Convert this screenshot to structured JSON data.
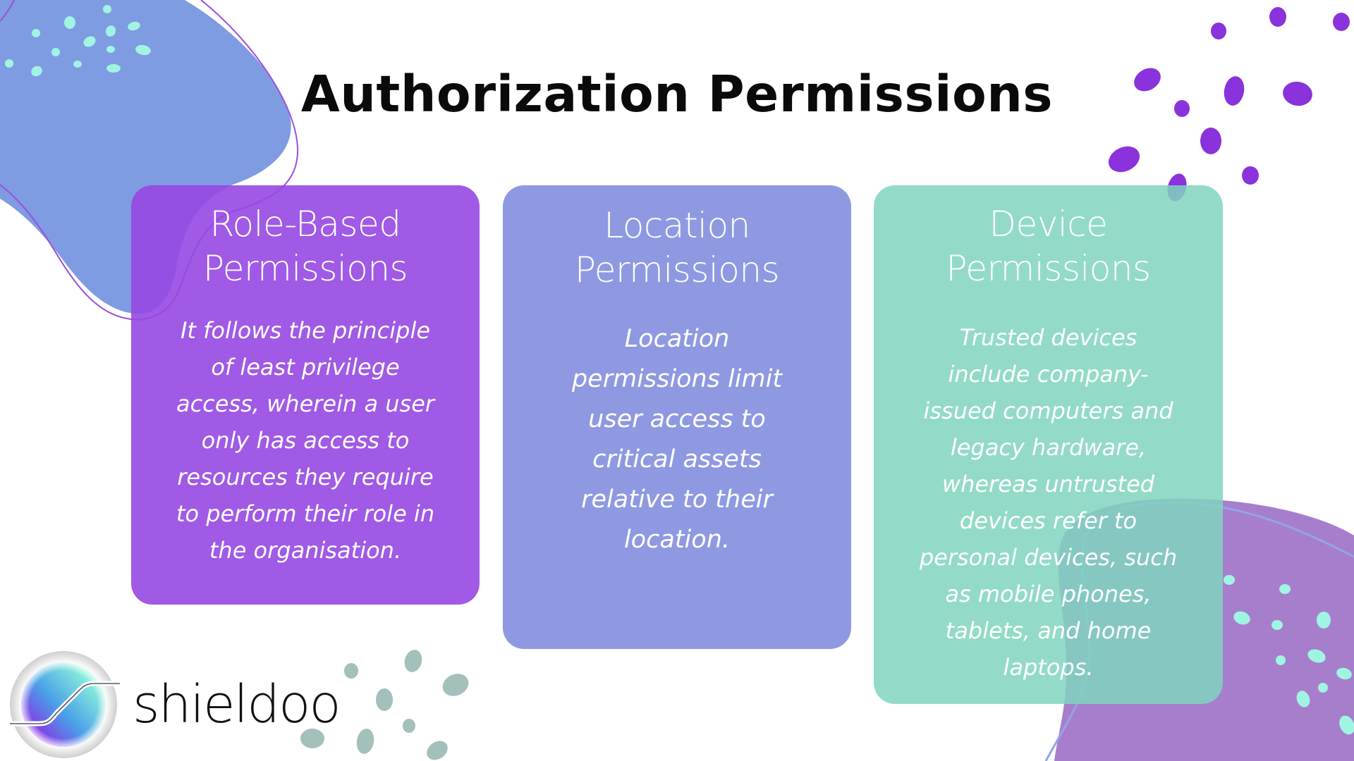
{
  "slide": {
    "title": "Authorization Permissions",
    "brand": {
      "name": "shieldoo",
      "logo_icon": "shieldoo-logo-icon"
    },
    "colors": {
      "card_role": "#9d55e3",
      "card_location": "#8f9ae2",
      "card_device": "#92dcc8",
      "blob_blue": "#7f9be2",
      "blob_purple": "#a77ecc",
      "dots_purple": "#8a32dc",
      "dots_cyan": "#a0f5e2",
      "dots_sage": "#a3c0ba"
    },
    "cards": [
      {
        "heading": [
          "Role-Based",
          "Permissions"
        ],
        "body": [
          "It follows the principle",
          "of least privilege",
          "access, wherein a user",
          "only has access to",
          "resources they require",
          "to perform their role in",
          "the organisation."
        ]
      },
      {
        "heading": [
          "Location",
          "Permissions"
        ],
        "body": [
          "Location",
          "permissions limit",
          "user access to",
          "critical assets",
          "relative to their",
          "location."
        ]
      },
      {
        "heading": [
          "Device",
          "Permissions"
        ],
        "body": [
          "Trusted devices",
          "include company-",
          "issued computers and",
          "legacy hardware,",
          "whereas untrusted",
          "devices refer to",
          "personal devices, such",
          "as mobile phones,",
          "tablets, and home",
          "laptops."
        ]
      }
    ]
  }
}
